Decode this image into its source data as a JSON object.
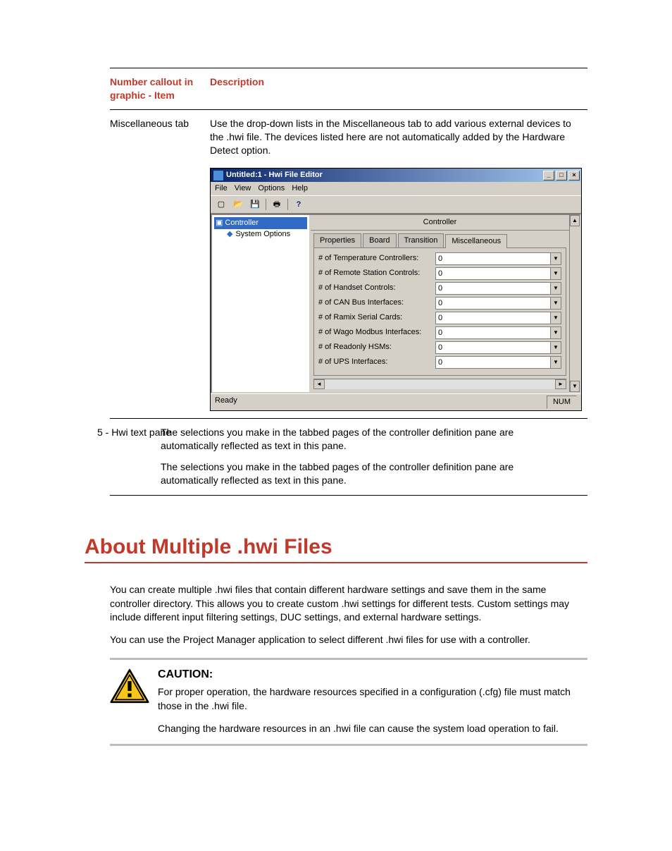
{
  "tableHeader": {
    "item": "Number callout in graphic - Item",
    "desc": "Description"
  },
  "rows": {
    "miscTab": {
      "item": "Miscellaneous tab",
      "desc": "Use the drop-down lists in the Miscellaneous tab to add various external devices to the .hwi file. The devices listed here are not automatically added by the Hardware Detect option."
    },
    "hwiPane": {
      "item": "5 - Hwi text pane",
      "desc1": "The selections you make in the tabbed pages of the controller definition pane are automatically reflected as text in this pane.",
      "desc2": "The selections you make in the tabbed pages of the controller definition pane are automatically reflected as text in this pane."
    }
  },
  "app": {
    "title": "Untitled:1 - Hwi File Editor",
    "menus": [
      "File",
      "View",
      "Options",
      "Help"
    ],
    "tree": {
      "root": "Controller",
      "child": "System Options"
    },
    "paneHeader": "Controller",
    "tabs": {
      "t1": "Properties",
      "t2": "Board",
      "t3": "Transition",
      "t4": "Miscellaneous"
    },
    "fields": [
      {
        "label": "# of Temperature Controllers:",
        "value": "0"
      },
      {
        "label": "# of Remote Station Controls:",
        "value": "0"
      },
      {
        "label": "# of Handset Controls:",
        "value": "0"
      },
      {
        "label": "# of CAN Bus Interfaces:",
        "value": "0"
      },
      {
        "label": "# of Ramix Serial Cards:",
        "value": "0"
      },
      {
        "label": "# of Wago Modbus Interfaces:",
        "value": "0"
      },
      {
        "label": "# of Readonly HSMs:",
        "value": "0"
      },
      {
        "label": "# of UPS Interfaces:",
        "value": "0"
      }
    ],
    "status": {
      "ready": "Ready",
      "num": "NUM"
    }
  },
  "section": {
    "heading": "About Multiple .hwi Files",
    "p1": "You can create multiple .hwi files that contain different hardware settings and save them in the same controller directory. This allows you to create custom .hwi settings for different tests. Custom settings may include different input filtering settings, DUC settings, and external hardware settings.",
    "p2": "You can use the Project Manager application to select different .hwi files for use with a controller."
  },
  "caution": {
    "title": "CAUTION:",
    "p1": "For proper operation, the hardware resources specified in a configuration (.cfg) file must match those in the .hwi file.",
    "p2": "Changing the hardware resources in an .hwi file can cause the system load operation to fail."
  }
}
